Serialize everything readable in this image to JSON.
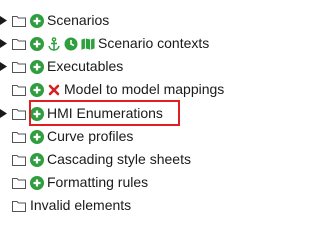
{
  "tree": {
    "items": [
      {
        "label": "Scenarios",
        "icons": [
          "add-icon"
        ],
        "expandable": true
      },
      {
        "label": "Scenario contexts",
        "icons": [
          "add-icon",
          "anchor-icon",
          "clock-icon",
          "map-icon"
        ],
        "expandable": true
      },
      {
        "label": "Executables",
        "icons": [
          "add-icon"
        ],
        "expandable": true
      },
      {
        "label": "Model to model mappings",
        "icons": [
          "add-icon",
          "delete-icon"
        ],
        "expandable": false
      },
      {
        "label": "HMI Enumerations",
        "icons": [
          "add-icon"
        ],
        "expandable": true,
        "highlighted": true
      },
      {
        "label": "Curve profiles",
        "icons": [
          "add-icon"
        ],
        "expandable": false
      },
      {
        "label": "Cascading style sheets",
        "icons": [
          "add-icon"
        ],
        "expandable": false
      },
      {
        "label": "Formatting rules",
        "icons": [
          "add-icon"
        ],
        "expandable": false
      },
      {
        "label": "Invalid elements",
        "icons": [],
        "expandable": false
      }
    ]
  },
  "colors": {
    "add": "#2e9e3e",
    "delete": "#d42020",
    "highlight_border": "#e02020",
    "folder_stroke": "#555555"
  }
}
